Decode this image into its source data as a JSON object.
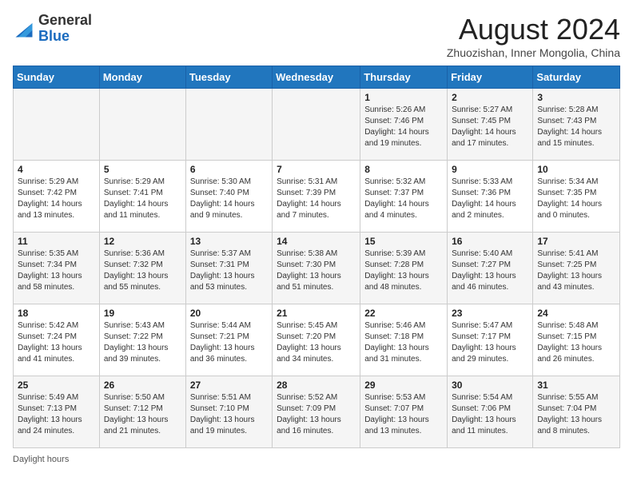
{
  "header": {
    "logo_general": "General",
    "logo_blue": "Blue",
    "month_title": "August 2024",
    "location": "Zhuozishan, Inner Mongolia, China"
  },
  "days_of_week": [
    "Sunday",
    "Monday",
    "Tuesday",
    "Wednesday",
    "Thursday",
    "Friday",
    "Saturday"
  ],
  "weeks": [
    [
      {
        "day": "",
        "info": ""
      },
      {
        "day": "",
        "info": ""
      },
      {
        "day": "",
        "info": ""
      },
      {
        "day": "",
        "info": ""
      },
      {
        "day": "1",
        "info": "Sunrise: 5:26 AM\nSunset: 7:46 PM\nDaylight: 14 hours\nand 19 minutes."
      },
      {
        "day": "2",
        "info": "Sunrise: 5:27 AM\nSunset: 7:45 PM\nDaylight: 14 hours\nand 17 minutes."
      },
      {
        "day": "3",
        "info": "Sunrise: 5:28 AM\nSunset: 7:43 PM\nDaylight: 14 hours\nand 15 minutes."
      }
    ],
    [
      {
        "day": "4",
        "info": "Sunrise: 5:29 AM\nSunset: 7:42 PM\nDaylight: 14 hours\nand 13 minutes."
      },
      {
        "day": "5",
        "info": "Sunrise: 5:29 AM\nSunset: 7:41 PM\nDaylight: 14 hours\nand 11 minutes."
      },
      {
        "day": "6",
        "info": "Sunrise: 5:30 AM\nSunset: 7:40 PM\nDaylight: 14 hours\nand 9 minutes."
      },
      {
        "day": "7",
        "info": "Sunrise: 5:31 AM\nSunset: 7:39 PM\nDaylight: 14 hours\nand 7 minutes."
      },
      {
        "day": "8",
        "info": "Sunrise: 5:32 AM\nSunset: 7:37 PM\nDaylight: 14 hours\nand 4 minutes."
      },
      {
        "day": "9",
        "info": "Sunrise: 5:33 AM\nSunset: 7:36 PM\nDaylight: 14 hours\nand 2 minutes."
      },
      {
        "day": "10",
        "info": "Sunrise: 5:34 AM\nSunset: 7:35 PM\nDaylight: 14 hours\nand 0 minutes."
      }
    ],
    [
      {
        "day": "11",
        "info": "Sunrise: 5:35 AM\nSunset: 7:34 PM\nDaylight: 13 hours\nand 58 minutes."
      },
      {
        "day": "12",
        "info": "Sunrise: 5:36 AM\nSunset: 7:32 PM\nDaylight: 13 hours\nand 55 minutes."
      },
      {
        "day": "13",
        "info": "Sunrise: 5:37 AM\nSunset: 7:31 PM\nDaylight: 13 hours\nand 53 minutes."
      },
      {
        "day": "14",
        "info": "Sunrise: 5:38 AM\nSunset: 7:30 PM\nDaylight: 13 hours\nand 51 minutes."
      },
      {
        "day": "15",
        "info": "Sunrise: 5:39 AM\nSunset: 7:28 PM\nDaylight: 13 hours\nand 48 minutes."
      },
      {
        "day": "16",
        "info": "Sunrise: 5:40 AM\nSunset: 7:27 PM\nDaylight: 13 hours\nand 46 minutes."
      },
      {
        "day": "17",
        "info": "Sunrise: 5:41 AM\nSunset: 7:25 PM\nDaylight: 13 hours\nand 43 minutes."
      }
    ],
    [
      {
        "day": "18",
        "info": "Sunrise: 5:42 AM\nSunset: 7:24 PM\nDaylight: 13 hours\nand 41 minutes."
      },
      {
        "day": "19",
        "info": "Sunrise: 5:43 AM\nSunset: 7:22 PM\nDaylight: 13 hours\nand 39 minutes."
      },
      {
        "day": "20",
        "info": "Sunrise: 5:44 AM\nSunset: 7:21 PM\nDaylight: 13 hours\nand 36 minutes."
      },
      {
        "day": "21",
        "info": "Sunrise: 5:45 AM\nSunset: 7:20 PM\nDaylight: 13 hours\nand 34 minutes."
      },
      {
        "day": "22",
        "info": "Sunrise: 5:46 AM\nSunset: 7:18 PM\nDaylight: 13 hours\nand 31 minutes."
      },
      {
        "day": "23",
        "info": "Sunrise: 5:47 AM\nSunset: 7:17 PM\nDaylight: 13 hours\nand 29 minutes."
      },
      {
        "day": "24",
        "info": "Sunrise: 5:48 AM\nSunset: 7:15 PM\nDaylight: 13 hours\nand 26 minutes."
      }
    ],
    [
      {
        "day": "25",
        "info": "Sunrise: 5:49 AM\nSunset: 7:13 PM\nDaylight: 13 hours\nand 24 minutes."
      },
      {
        "day": "26",
        "info": "Sunrise: 5:50 AM\nSunset: 7:12 PM\nDaylight: 13 hours\nand 21 minutes."
      },
      {
        "day": "27",
        "info": "Sunrise: 5:51 AM\nSunset: 7:10 PM\nDaylight: 13 hours\nand 19 minutes."
      },
      {
        "day": "28",
        "info": "Sunrise: 5:52 AM\nSunset: 7:09 PM\nDaylight: 13 hours\nand 16 minutes."
      },
      {
        "day": "29",
        "info": "Sunrise: 5:53 AM\nSunset: 7:07 PM\nDaylight: 13 hours\nand 13 minutes."
      },
      {
        "day": "30",
        "info": "Sunrise: 5:54 AM\nSunset: 7:06 PM\nDaylight: 13 hours\nand 11 minutes."
      },
      {
        "day": "31",
        "info": "Sunrise: 5:55 AM\nSunset: 7:04 PM\nDaylight: 13 hours\nand 8 minutes."
      }
    ]
  ],
  "footer": {
    "daylight_label": "Daylight hours"
  }
}
